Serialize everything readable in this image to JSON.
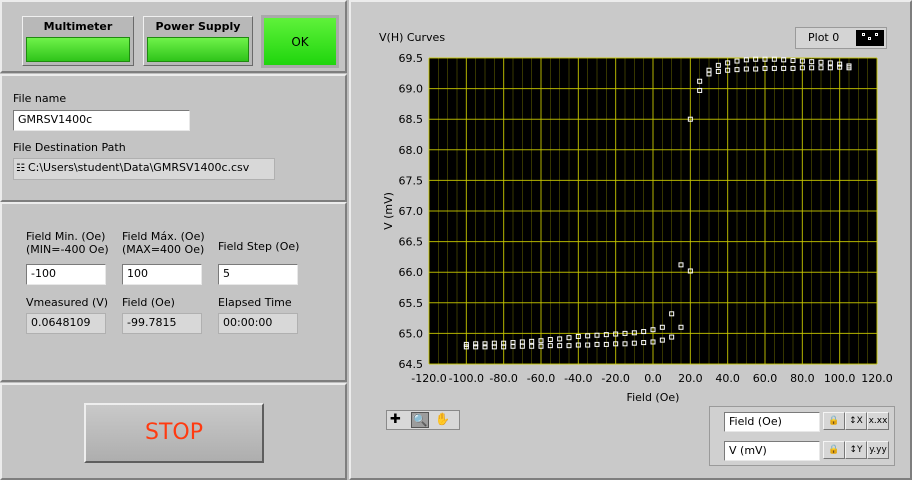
{
  "buttons": {
    "multimeter": "Multimeter",
    "power_supply": "Power Supply",
    "ok": "OK",
    "stop": "STOP"
  },
  "file": {
    "name_label": "File name",
    "name_value": "GMRSV1400c",
    "path_label": "File Destination Path",
    "path_value": "C:\\Users\\student\\Data\\GMRSV1400c.csv"
  },
  "params": {
    "field_min_label": "Field Min. (Oe)\n(MIN=-400 Oe)",
    "field_min_value": "-100",
    "field_max_label": "Field Máx. (Oe)\n(MAX=400 Oe)",
    "field_max_value": "100",
    "field_step_label": "Field Step (Oe)",
    "field_step_value": "5",
    "vmeasured_label": "Vmeasured (V)",
    "vmeasured_value": "0.0648109",
    "field_label": "Field (Oe)",
    "field_value": "-99.7815",
    "elapsed_label": "Elapsed Time",
    "elapsed_value": "00:00:00"
  },
  "graph": {
    "title": "V(H) Curves",
    "legend": "Plot 0",
    "x_scale_name": "Field (Oe)",
    "y_scale_name": "V (mV)"
  },
  "colors": {
    "plot_bg": "#000000",
    "grid": "#c8c800",
    "marker": "#ffffff",
    "led_green": "#3fdc20",
    "stop_text": "#ff3a10"
  },
  "chart_data": {
    "type": "scatter",
    "title": "V(H) Curves",
    "xlabel": "Field (Oe)",
    "ylabel": "V (mV)",
    "xlim": [
      -120,
      120
    ],
    "ylim": [
      64.5,
      69.5
    ],
    "x_ticks": [
      "-120.0",
      "-100.0",
      "-80.0",
      "-60.0",
      "-40.0",
      "-20.0",
      "0.0",
      "20.0",
      "40.0",
      "60.0",
      "80.0",
      "100.0",
      "120.0"
    ],
    "y_ticks": [
      "64.5",
      "65.0",
      "65.5",
      "66.0",
      "66.5",
      "67.0",
      "67.5",
      "68.0",
      "68.5",
      "69.0",
      "69.5"
    ],
    "grid": true,
    "legend": "top-right",
    "series": [
      {
        "name": "Plot 0",
        "points": [
          [
            -100,
            64.82
          ],
          [
            -95,
            64.83
          ],
          [
            -90,
            64.83
          ],
          [
            -85,
            64.84
          ],
          [
            -80,
            64.84
          ],
          [
            -75,
            64.85
          ],
          [
            -70,
            64.86
          ],
          [
            -65,
            64.87
          ],
          [
            -60,
            64.88
          ],
          [
            -55,
            64.9
          ],
          [
            -50,
            64.91
          ],
          [
            -45,
            64.93
          ],
          [
            -40,
            64.95
          ],
          [
            -35,
            64.96
          ],
          [
            -30,
            64.97
          ],
          [
            -25,
            64.98
          ],
          [
            -20,
            64.99
          ],
          [
            -15,
            65.0
          ],
          [
            -10,
            65.01
          ],
          [
            -5,
            65.03
          ],
          [
            0,
            65.06
          ],
          [
            5,
            65.1
          ],
          [
            10,
            65.32
          ],
          [
            15,
            66.12
          ],
          [
            20,
            68.5
          ],
          [
            25,
            69.12
          ],
          [
            30,
            69.3
          ],
          [
            35,
            69.38
          ],
          [
            40,
            69.42
          ],
          [
            45,
            69.45
          ],
          [
            50,
            69.47
          ],
          [
            55,
            69.48
          ],
          [
            60,
            69.48
          ],
          [
            65,
            69.48
          ],
          [
            70,
            69.47
          ],
          [
            75,
            69.46
          ],
          [
            80,
            69.45
          ],
          [
            85,
            69.44
          ],
          [
            90,
            69.43
          ],
          [
            95,
            69.42
          ],
          [
            100,
            69.4
          ],
          [
            105,
            69.37
          ],
          [
            105,
            69.34
          ],
          [
            100,
            69.35
          ],
          [
            95,
            69.34
          ],
          [
            90,
            69.34
          ],
          [
            85,
            69.34
          ],
          [
            80,
            69.34
          ],
          [
            75,
            69.33
          ],
          [
            70,
            69.33
          ],
          [
            65,
            69.33
          ],
          [
            60,
            69.33
          ],
          [
            55,
            69.32
          ],
          [
            50,
            69.32
          ],
          [
            45,
            69.31
          ],
          [
            40,
            69.3
          ],
          [
            35,
            69.28
          ],
          [
            30,
            69.24
          ],
          [
            25,
            68.97
          ],
          [
            20,
            66.02
          ],
          [
            15,
            65.1
          ],
          [
            10,
            64.94
          ],
          [
            5,
            64.89
          ],
          [
            0,
            64.86
          ],
          [
            -5,
            64.85
          ],
          [
            -10,
            64.84
          ],
          [
            -15,
            64.83
          ],
          [
            -20,
            64.83
          ],
          [
            -25,
            64.82
          ],
          [
            -30,
            64.82
          ],
          [
            -35,
            64.81
          ],
          [
            -40,
            64.81
          ],
          [
            -45,
            64.8
          ],
          [
            -50,
            64.8
          ],
          [
            -55,
            64.8
          ],
          [
            -60,
            64.79
          ],
          [
            -65,
            64.79
          ],
          [
            -70,
            64.79
          ],
          [
            -75,
            64.79
          ],
          [
            -80,
            64.78
          ],
          [
            -85,
            64.78
          ],
          [
            -90,
            64.78
          ],
          [
            -95,
            64.78
          ],
          [
            -100,
            64.78
          ]
        ]
      }
    ]
  }
}
